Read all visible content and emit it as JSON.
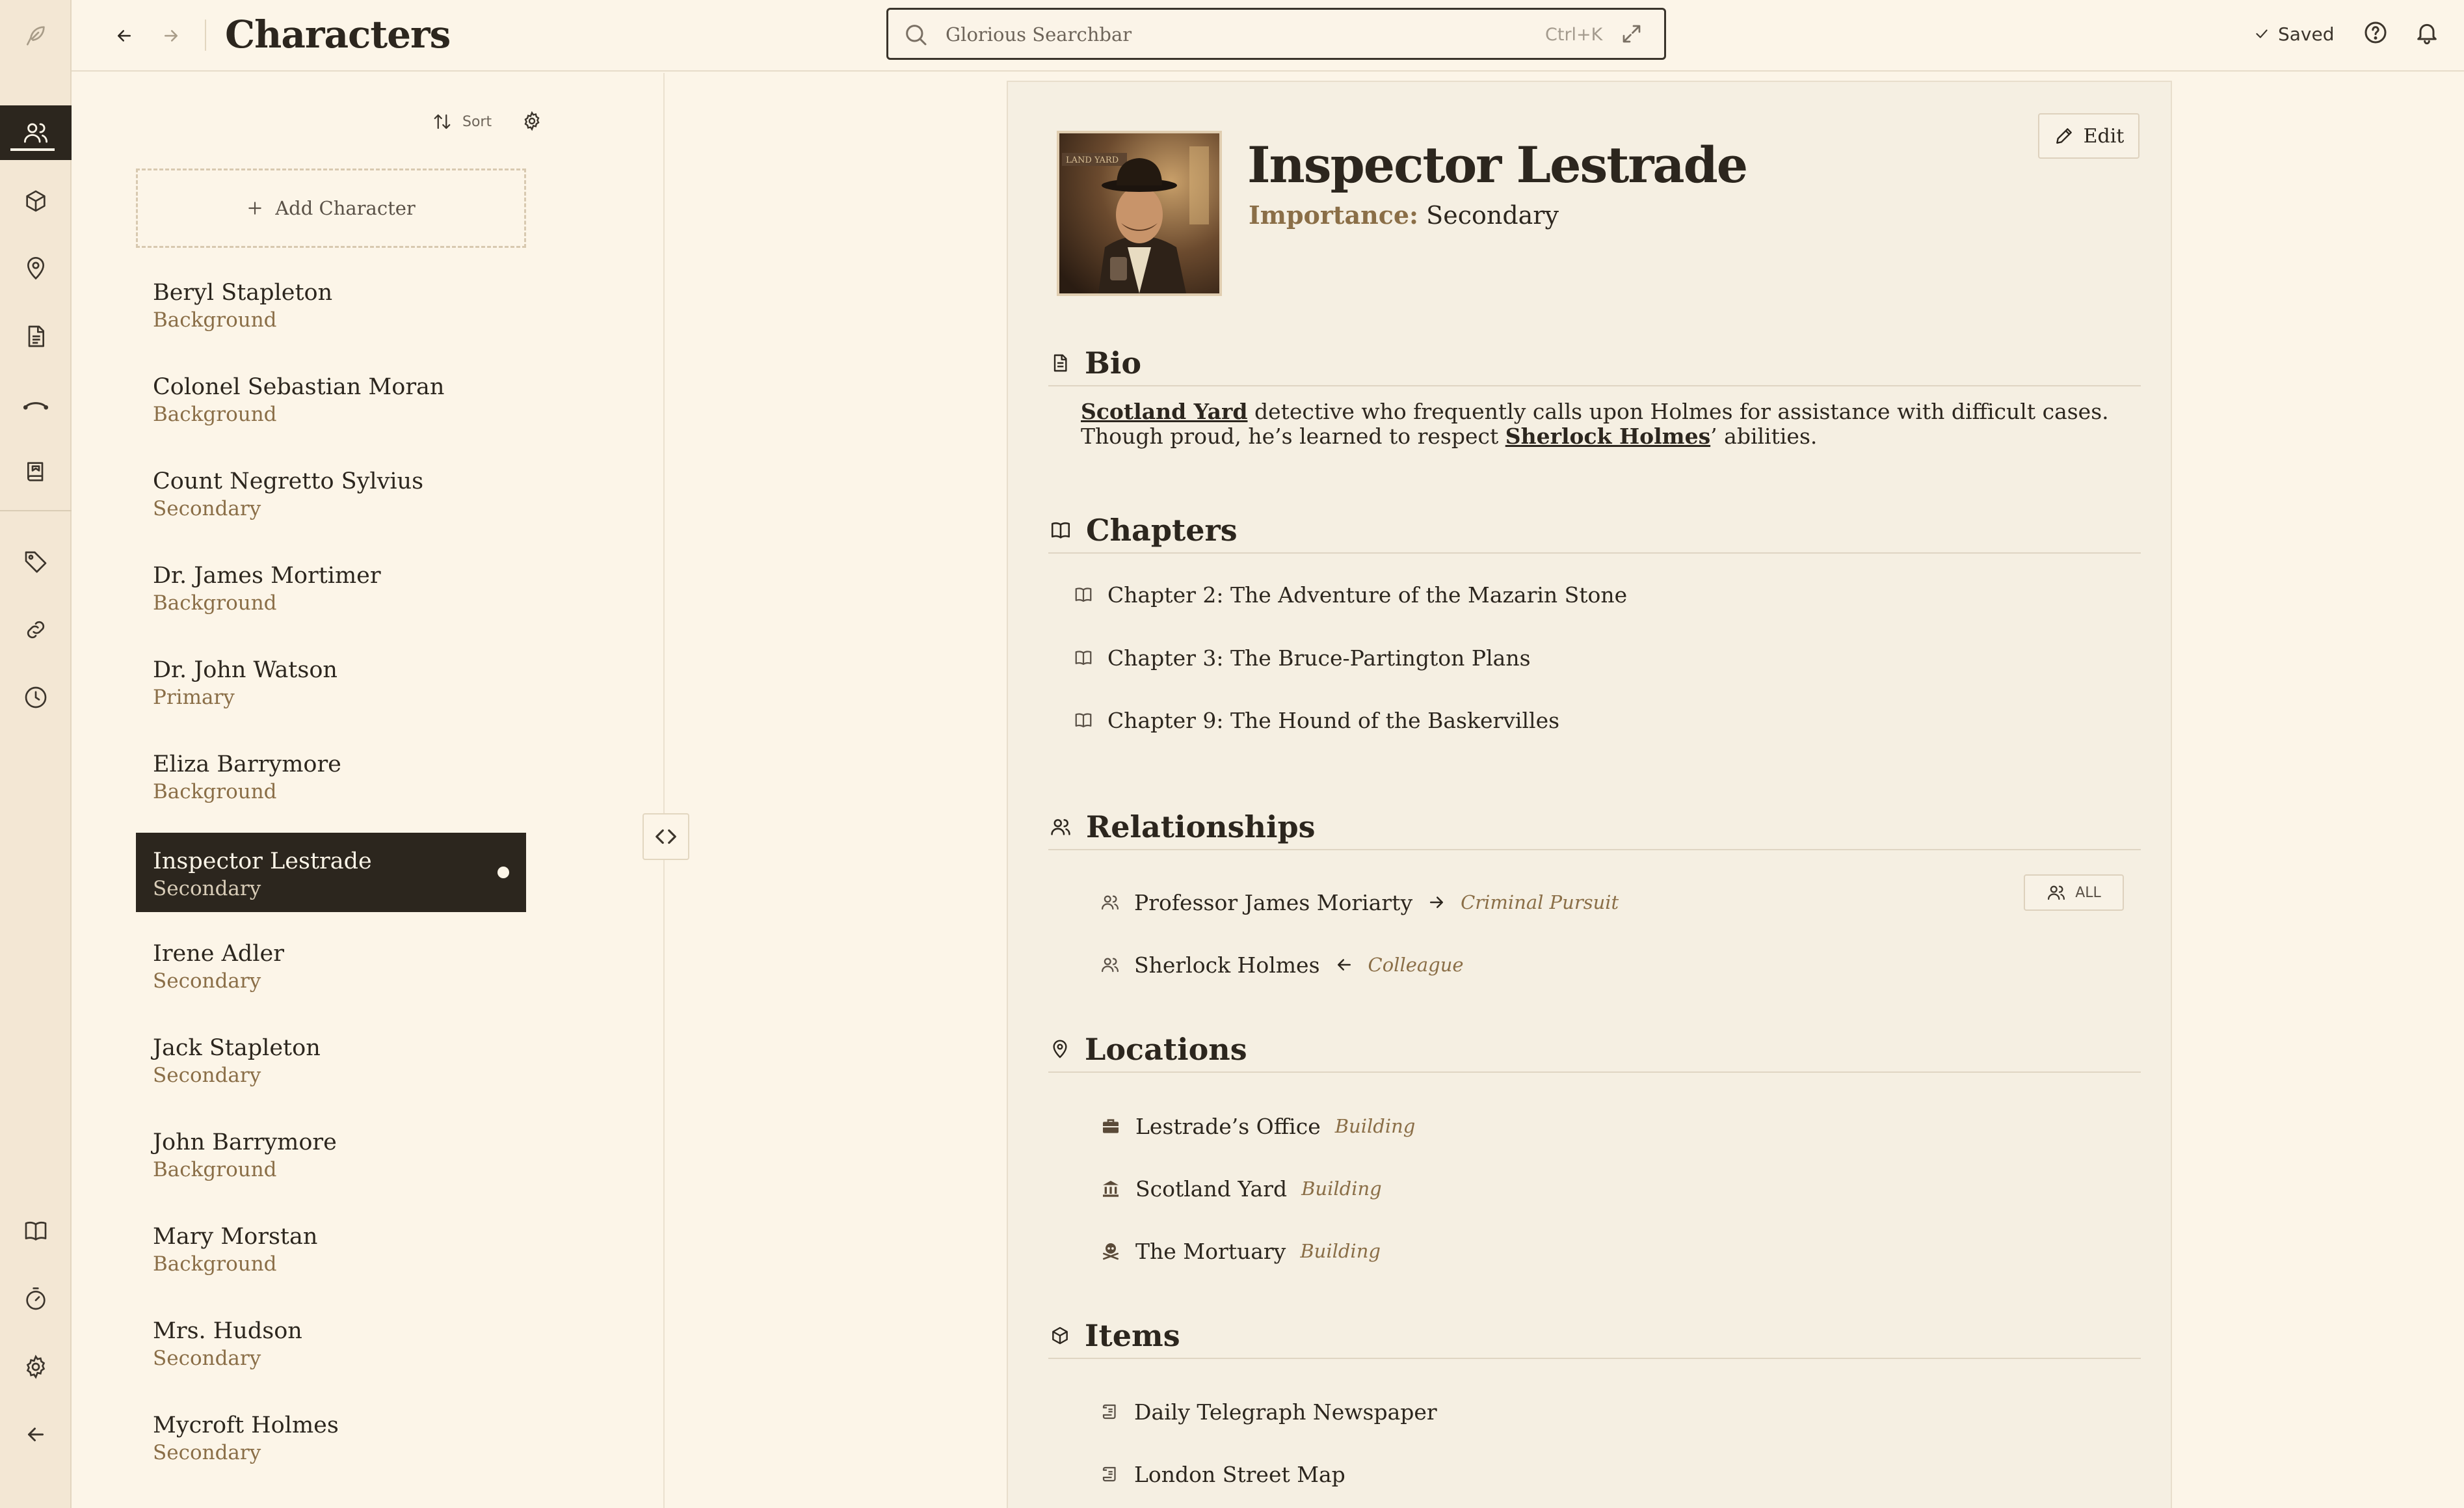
{
  "topbar": {
    "title": "Characters",
    "search_placeholder": "Glorious Searchbar",
    "search_shortcut": "Ctrl+K",
    "saved_label": "Saved"
  },
  "rail": {
    "top_items": [
      "characters-icon",
      "items-icon",
      "locations-icon",
      "documents-icon",
      "arcs-icon",
      "lore-icon"
    ],
    "mid_items": [
      "tags-icon",
      "links-icon",
      "timeline-icon"
    ],
    "bottom_items": [
      "book-icon",
      "timer-icon",
      "settings-icon",
      "collapse-left-icon"
    ]
  },
  "list": {
    "sort_label": "Sort",
    "add_label": "Add Character",
    "characters": [
      {
        "name": "Beryl Stapleton",
        "role": "Background"
      },
      {
        "name": "Colonel Sebastian Moran",
        "role": "Background"
      },
      {
        "name": "Count Negretto Sylvius",
        "role": "Secondary"
      },
      {
        "name": "Dr. James Mortimer",
        "role": "Background"
      },
      {
        "name": "Dr. John Watson",
        "role": "Primary"
      },
      {
        "name": "Eliza Barrymore",
        "role": "Background"
      },
      {
        "name": "Inspector Lestrade",
        "role": "Secondary"
      },
      {
        "name": "Irene Adler",
        "role": "Secondary"
      },
      {
        "name": "Jack Stapleton",
        "role": "Secondary"
      },
      {
        "name": "John Barrymore",
        "role": "Background"
      },
      {
        "name": "Mary Morstan",
        "role": "Background"
      },
      {
        "name": "Mrs. Hudson",
        "role": "Secondary"
      },
      {
        "name": "Mycroft Holmes",
        "role": "Secondary"
      }
    ]
  },
  "detail": {
    "name": "Inspector Lestrade",
    "importance_label": "Importance:",
    "importance_value": "Secondary",
    "edit_label": "Edit",
    "portrait_sign": "LAND YARD",
    "bio_heading": "Bio",
    "bio": {
      "link1": "Scotland Yard",
      "text1": " detective who frequently calls upon Holmes for assistance with difficult cases. Though proud, he’s learned to respect ",
      "link2": "Sherlock Holmes",
      "text2": "’ abilities."
    },
    "chapters_heading": "Chapters",
    "chapters": [
      "Chapter 2: The Adventure of the Mazarin Stone",
      "Chapter 3: The Bruce-Partington Plans",
      "Chapter 9: The Hound of the Baskervilles"
    ],
    "relationships_heading": "Relationships",
    "relationships_all": "ALL",
    "relationships": [
      {
        "name": "Professor James Moriarty",
        "arrow": "→",
        "type": "Criminal Pursuit"
      },
      {
        "name": "Sherlock Holmes",
        "arrow": "←",
        "type": "Colleague"
      }
    ],
    "locations_heading": "Locations",
    "locations": [
      {
        "name": "Lestrade’s Office",
        "type": "Building",
        "icon": "briefcase-icon"
      },
      {
        "name": "Scotland Yard",
        "type": "Building",
        "icon": "bank-icon"
      },
      {
        "name": "The Mortuary",
        "type": "Building",
        "icon": "skull-icon"
      }
    ],
    "items_heading": "Items",
    "items": [
      "Daily Telegraph Newspaper",
      "London Street Map"
    ]
  }
}
